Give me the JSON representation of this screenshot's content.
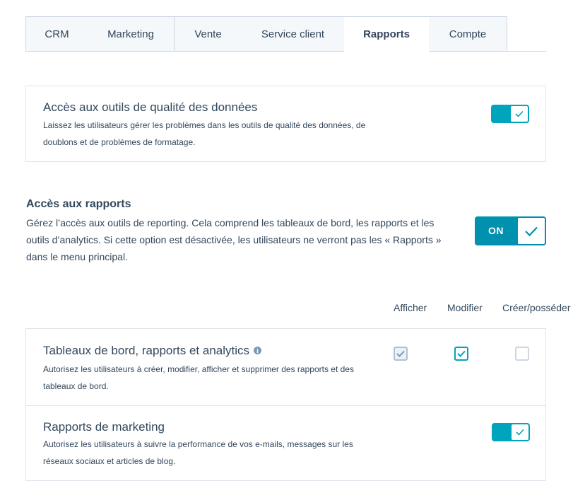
{
  "tabs": [
    {
      "label": "CRM"
    },
    {
      "label": "Marketing"
    },
    {
      "label": "Vente"
    },
    {
      "label": "Service client"
    },
    {
      "label": "Rapports",
      "active": true
    },
    {
      "label": "Compte"
    }
  ],
  "data_quality": {
    "title": "Accès aux outils de qualité des données",
    "description": "Laissez les utilisateurs gérer les problèmes dans les outils de qualité des données, de doublons et de problèmes de formatage.",
    "enabled": true
  },
  "reports_access": {
    "title": "Accès aux rapports",
    "description": "Gérez l’accès aux outils de reporting. Cela comprend les tableaux de bord, les rapports et les outils d’analytics. Si cette option est désactivée, les utilisateurs ne verront pas les « Rapports » dans le menu principal.",
    "toggle_label": "ON",
    "enabled": true
  },
  "permission_columns": {
    "view": "Afficher",
    "edit": "Modifier",
    "create_own": "Créer/posséder"
  },
  "dashboards": {
    "title": "Tableaux de bord, rapports et analytics",
    "info_glyph": "i",
    "description": "Autorisez les utilisateurs à créer, modifier, afficher et supprimer des rapports et des tableaux de bord.",
    "view": "checked-disabled",
    "edit": "checked",
    "create_own": "unchecked"
  },
  "marketing_reports": {
    "title": "Rapports de marketing",
    "description": "Autorisez les utilisateurs à suivre la performance de vos e-mails, messages sur les réseaux sociaux et articles de blog.",
    "enabled": true
  },
  "colors": {
    "accent": "#00a4bd",
    "accent_dark": "#0091ae",
    "text": "#33475b",
    "border": "#dfe3eb"
  }
}
